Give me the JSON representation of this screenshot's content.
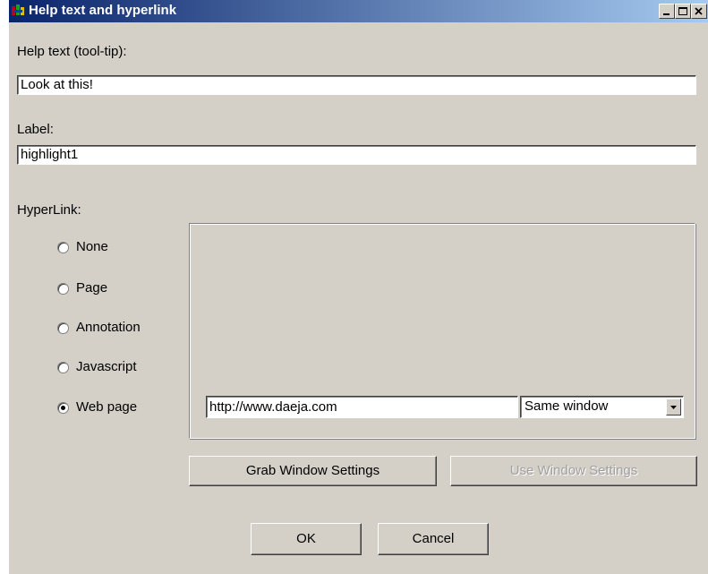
{
  "window": {
    "title": "Help text and hyperlink",
    "controls": [
      "minimize-icon",
      "maximize-icon",
      "close-icon"
    ]
  },
  "help_text": {
    "label": "Help text  (tool-tip):",
    "value": "Look at this!"
  },
  "label_field": {
    "label": "Label:",
    "value": "highlight1"
  },
  "hyperlink": {
    "label": "HyperLink:",
    "options": [
      {
        "label": "None",
        "checked": false
      },
      {
        "label": "Page",
        "checked": false
      },
      {
        "label": "Annotation",
        "checked": false
      },
      {
        "label": "Javascript",
        "checked": false
      },
      {
        "label": "Web page",
        "checked": true
      }
    ],
    "url": "http://www.daeja.com",
    "target": {
      "selected": "Same window",
      "icon": "chevron-down-icon"
    }
  },
  "buttons": {
    "grab": "Grab Window Settings",
    "use": "Use Window Settings",
    "ok": "OK",
    "cancel": "Cancel"
  }
}
